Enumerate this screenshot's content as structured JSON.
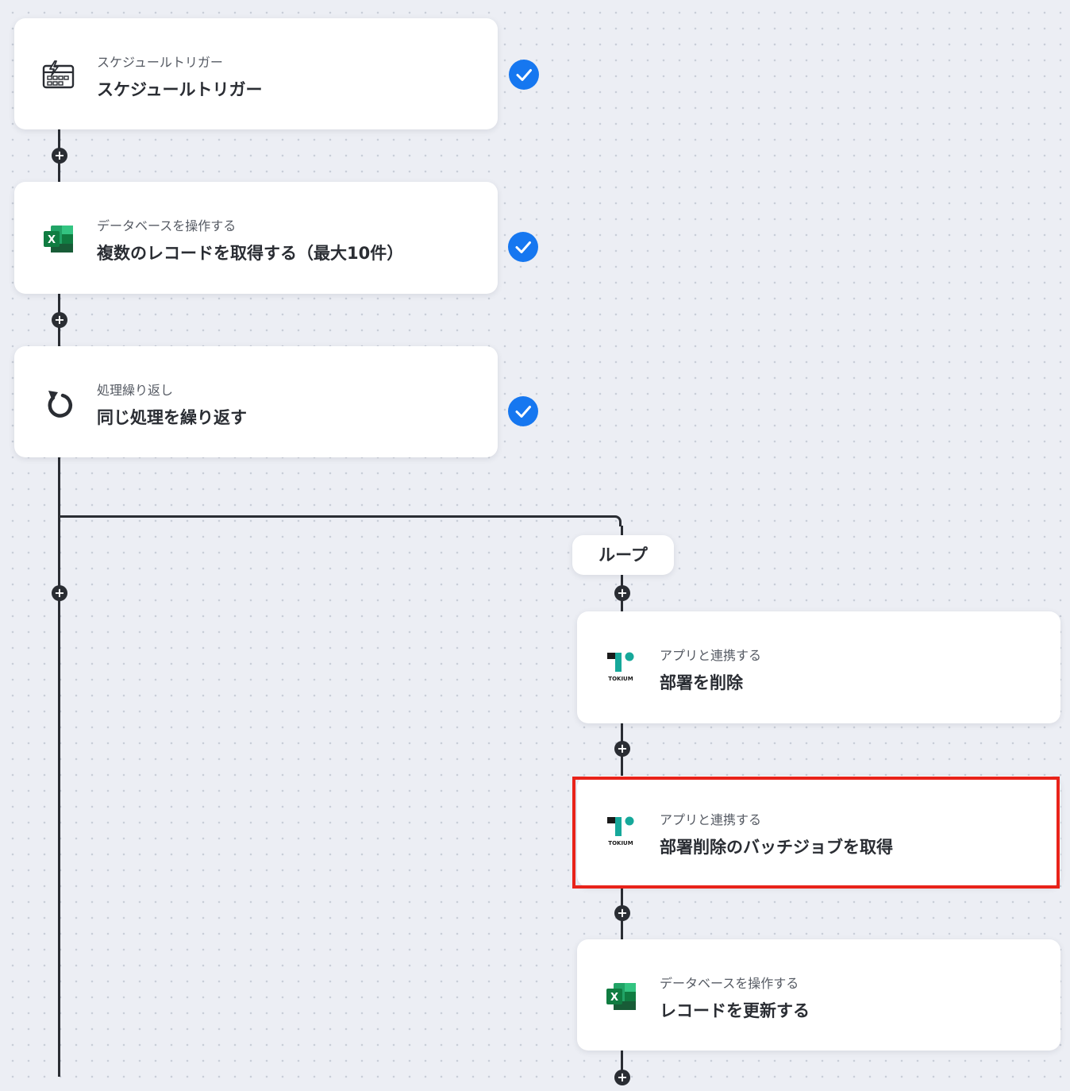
{
  "colors": {
    "line": "#2a2d33",
    "check": "#1677f0",
    "highlight": "#e8231a",
    "excel_green": "#1e7145",
    "tokium_teal": "#16a89a"
  },
  "main_flow": [
    {
      "subtitle": "スケジュールトリガー",
      "title": "スケジュールトリガー",
      "icon": "calendar-lightning-icon",
      "completed": true
    },
    {
      "subtitle": "データベースを操作する",
      "title": "複数のレコードを取得する（最大10件）",
      "icon": "excel-icon",
      "completed": true
    },
    {
      "subtitle": "処理繰り返し",
      "title": "同じ処理を繰り返す",
      "icon": "loop-arrow-icon",
      "completed": true
    }
  ],
  "loop": {
    "label": "ループ",
    "steps": [
      {
        "subtitle": "アプリと連携する",
        "title": "部署を削除",
        "icon": "tokium-logo-icon",
        "logo_text": "TOKIUM"
      },
      {
        "subtitle": "アプリと連携する",
        "title": "部署削除のバッチジョブを取得",
        "icon": "tokium-logo-icon",
        "logo_text": "TOKIUM",
        "highlighted": true
      },
      {
        "subtitle": "データベースを操作する",
        "title": "レコードを更新する",
        "icon": "excel-icon"
      }
    ]
  },
  "add_step_symbol": "+"
}
